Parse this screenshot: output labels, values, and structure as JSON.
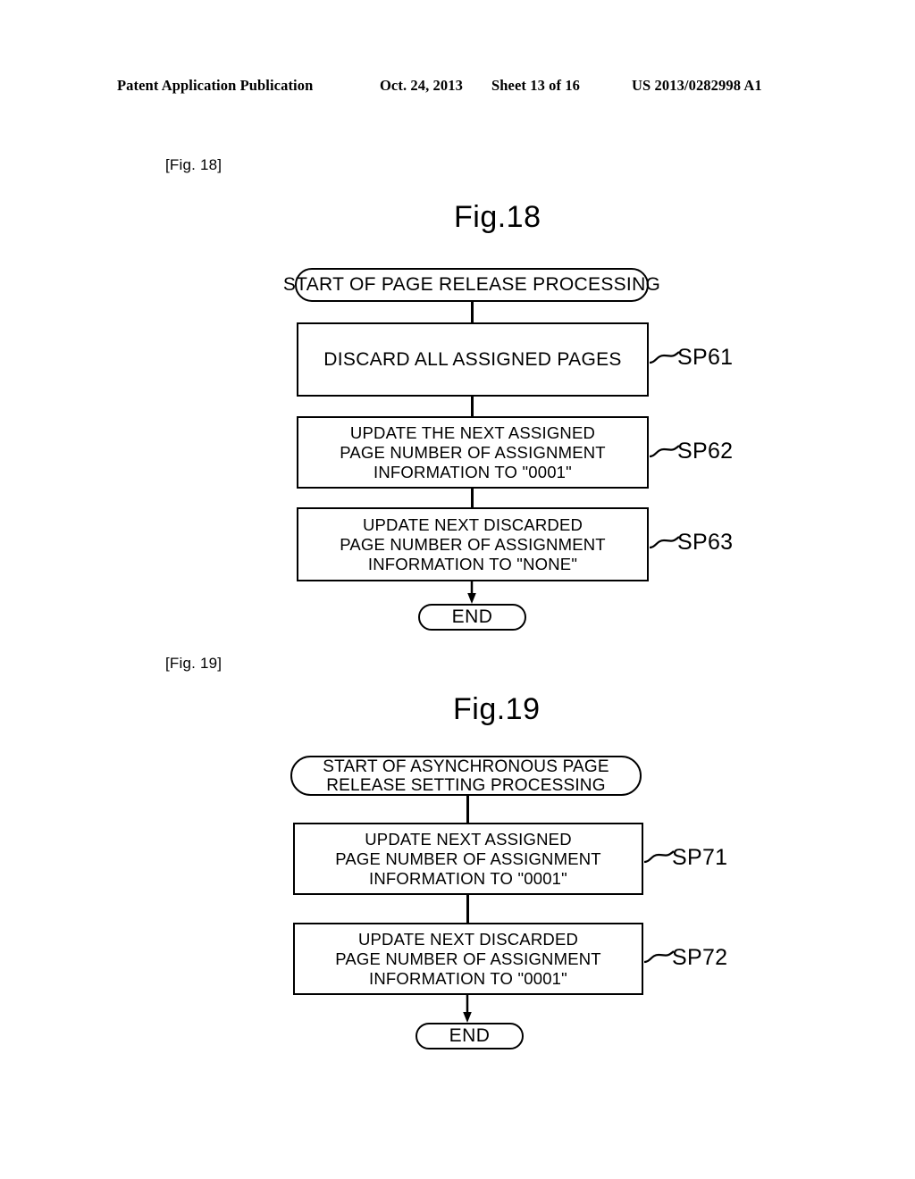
{
  "header": {
    "publication": "Patent Application Publication",
    "date": "Oct. 24, 2013",
    "sheet": "Sheet 13 of 16",
    "patent_number": "US 2013/0282998 A1"
  },
  "figures": [
    {
      "tag": "[Fig. 18]",
      "caption": "Fig.18",
      "start": {
        "label": "START OF PAGE RELEASE PROCESSING"
      },
      "steps": [
        {
          "id": "SP61",
          "lines": [
            "DISCARD ALL ASSIGNED PAGES"
          ]
        },
        {
          "id": "SP62",
          "lines": [
            "UPDATE THE NEXT ASSIGNED",
            "PAGE NUMBER OF ASSIGNMENT",
            "INFORMATION TO \"0001\""
          ]
        },
        {
          "id": "SP63",
          "lines": [
            "UPDATE NEXT DISCARDED",
            "PAGE NUMBER OF ASSIGNMENT",
            "INFORMATION TO \"NONE\""
          ]
        }
      ],
      "end": {
        "label": "END"
      }
    },
    {
      "tag": "[Fig. 19]",
      "caption": "Fig.19",
      "start": {
        "lines": [
          "START OF ASYNCHRONOUS PAGE",
          "RELEASE SETTING PROCESSING"
        ]
      },
      "steps": [
        {
          "id": "SP71",
          "lines": [
            "UPDATE NEXT ASSIGNED",
            "PAGE NUMBER OF ASSIGNMENT",
            "INFORMATION TO \"0001\""
          ]
        },
        {
          "id": "SP72",
          "lines": [
            "UPDATE NEXT DISCARDED",
            "PAGE NUMBER OF ASSIGNMENT",
            "INFORMATION TO \"0001\""
          ]
        }
      ],
      "end": {
        "label": "END"
      }
    }
  ],
  "colors": {
    "ink": "#000000",
    "paper": "#ffffff"
  }
}
